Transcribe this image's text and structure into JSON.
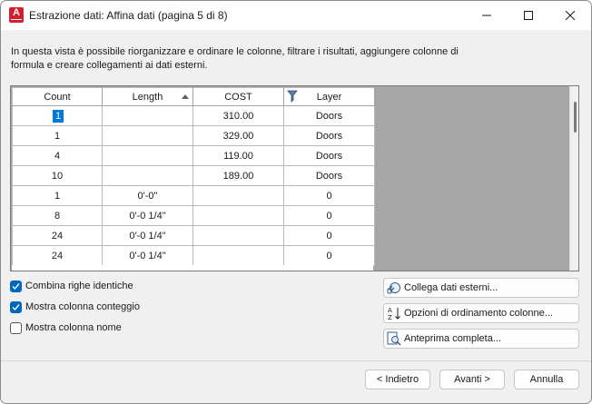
{
  "window": {
    "title": "Estrazione dati: Affina dati (pagina 5 di 8)",
    "app_icon_letter": "A"
  },
  "description": "In questa vista è possibile riorganizzare e ordinare le colonne, filtrare i risultati, aggiungere colonne di formula e creare collegamenti ai dati esterni.",
  "grid": {
    "columns": [
      "Count",
      "Length",
      "COST",
      "Layer"
    ],
    "sorted_column": "Length",
    "filtered_column": "Layer",
    "rows": [
      [
        "1",
        "",
        "310.00",
        "Doors"
      ],
      [
        "1",
        "",
        "329.00",
        "Doors"
      ],
      [
        "4",
        "",
        "119.00",
        "Doors"
      ],
      [
        "10",
        "",
        "189.00",
        "Doors"
      ],
      [
        "1",
        "0'-0\"",
        "",
        "0"
      ],
      [
        "8",
        "0'-0 1/4\"",
        "",
        "0"
      ],
      [
        "24",
        "0'-0 1/4\"",
        "",
        "0"
      ],
      [
        "24",
        "0'-0 1/4\"",
        "",
        "0"
      ]
    ]
  },
  "options": {
    "combine_rows": {
      "label": "Combina righe identiche",
      "checked": true
    },
    "show_count": {
      "label": "Mostra colonna conteggio",
      "checked": true
    },
    "show_name": {
      "label": "Mostra colonna nome",
      "checked": false
    }
  },
  "side_buttons": {
    "link_external": "Collega dati esterni...",
    "sort_options": "Opzioni di ordinamento colonne...",
    "preview": "Anteprima completa..."
  },
  "footer": {
    "back": "< Indietro",
    "next": "Avanti >",
    "cancel": "Annulla"
  },
  "colors": {
    "accent": "#0067c0",
    "selection": "#0078d7",
    "app_icon": "#d21f2e"
  }
}
